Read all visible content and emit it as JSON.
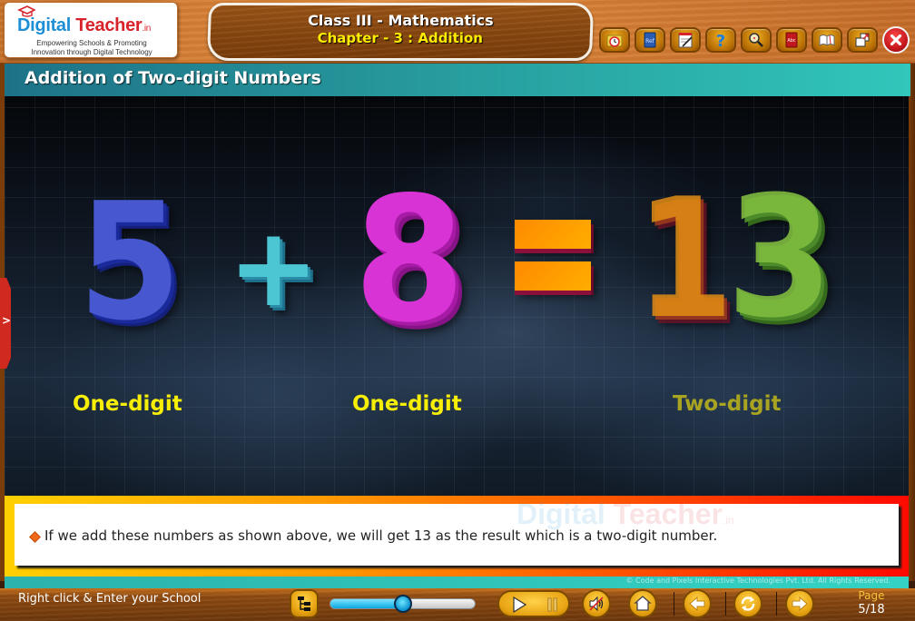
{
  "header": {
    "logo": {
      "brand_part1": "Digital",
      "brand_part2": "Teacher",
      "brand_suffix": ".in",
      "tagline_line1": "Empowering Schools & Promoting",
      "tagline_line2": "Innovation through Digital Technology"
    },
    "course_title": "Class III - Mathematics",
    "chapter_title": "Chapter - 3 : Addition",
    "toolbar": [
      {
        "name": "history",
        "icon": "folder-clock-icon"
      },
      {
        "name": "reference",
        "icon": "ref-book-icon",
        "label": "Ref"
      },
      {
        "name": "notes",
        "icon": "notepad-pen-icon"
      },
      {
        "name": "help",
        "icon": "question-mark-icon",
        "label": "?"
      },
      {
        "name": "search",
        "icon": "magnifier-icon"
      },
      {
        "name": "dictionary",
        "icon": "abc-book-icon",
        "label": "Abc"
      },
      {
        "name": "open-book",
        "icon": "open-book-icon"
      },
      {
        "name": "window",
        "icon": "restore-window-icon"
      },
      {
        "name": "close",
        "icon": "close-icon"
      }
    ]
  },
  "slide": {
    "heading": "Addition of Two-digit Numbers",
    "equation": {
      "operand1": "5",
      "operator": "+",
      "operand2": "8",
      "equals": "=",
      "result_tens": "1",
      "result_ones": "3"
    },
    "labels": [
      "One-digit",
      "One-digit",
      "Two-digit"
    ],
    "side_tab": ">"
  },
  "note": {
    "watermark_part1": "Digital",
    "watermark_part2": "Teacher",
    "watermark_suffix": ".in",
    "text": "If we add these numbers as shown above, we will get 13 as the result which is a two-digit number."
  },
  "copyright": "© Code and Pixels Interactive Technologies  Pvt. Ltd. All Rights Reserved.",
  "footer": {
    "school_link": "Right click & Enter your School",
    "progress_fraction": 0.5,
    "page_label": "Page",
    "page_current": "5/18"
  },
  "colors": {
    "heading_teal": "#26999c",
    "label_yellow": "#f7ee07",
    "label_olive": "#a8a321",
    "digit5": "#4757d0",
    "plus": "#4dc6d4",
    "digit8": "#d833d4",
    "equals": "#ff9a00",
    "digit1": "#e28c14",
    "digit3": "#7eba3e"
  }
}
